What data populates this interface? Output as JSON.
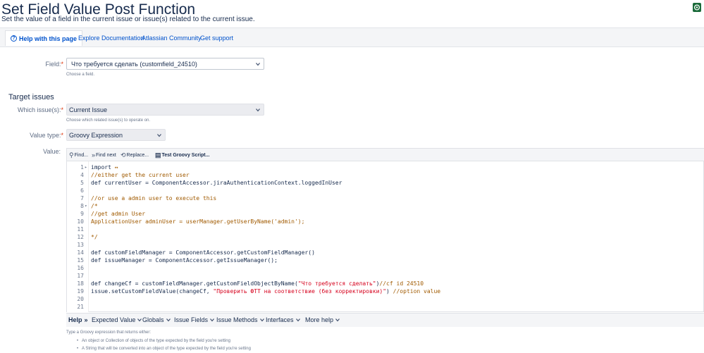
{
  "header": {
    "title": "Set Field Value Post Function",
    "subtitle": "Set the value of a field in the current issue or issue(s) related to the current issue."
  },
  "help_bar": {
    "active_tab": "Help with this page",
    "links": [
      "Explore Documentation",
      "Atlassian Community",
      "Get support"
    ]
  },
  "form": {
    "field": {
      "label": "Field:",
      "required_mark": "*",
      "value": "Что требуется сделать (customfield_24510)",
      "hint": "Choose a field."
    },
    "target_issues": {
      "title": "Target issues",
      "label": "Which issue(s):",
      "required_mark": "*",
      "value": "Current Issue",
      "hint": "Choose which related issue(s) to operate on."
    },
    "value_type": {
      "label": "Value type:",
      "required_mark": "*",
      "value": "Groovy Expression"
    },
    "value": {
      "label": "Value:"
    }
  },
  "editor": {
    "toolbar": {
      "find": "Find...",
      "find_next": "Find next",
      "replace": "Replace...",
      "test_script": "Test Groovy Script..."
    },
    "lines": [
      {
        "n": "1",
        "fold": "▸",
        "parts": [
          {
            "t": "import ",
            "c": "kw"
          },
          {
            "t": "↔",
            "c": "cm"
          }
        ]
      },
      {
        "n": "4",
        "fold": "",
        "parts": [
          {
            "t": "//either get the current user",
            "c": "cm"
          }
        ]
      },
      {
        "n": "5",
        "fold": "",
        "parts": [
          {
            "t": "def currentUser = ComponentAccessor.jiraAuthenticationContext.loggedInUser",
            "c": "kw"
          }
        ]
      },
      {
        "n": "6",
        "fold": "",
        "parts": []
      },
      {
        "n": "7",
        "fold": "",
        "parts": [
          {
            "t": "//or use a admin user to execute this",
            "c": "cm"
          }
        ]
      },
      {
        "n": "8",
        "fold": "▾",
        "parts": [
          {
            "t": "/*",
            "c": "cm"
          }
        ]
      },
      {
        "n": "9",
        "fold": "",
        "parts": [
          {
            "t": "//get admin User",
            "c": "cm"
          }
        ]
      },
      {
        "n": "10",
        "fold": "",
        "parts": [
          {
            "t": "ApplicationUser adminUser = userManager.getUserByName('admin');",
            "c": "cm"
          }
        ]
      },
      {
        "n": "11",
        "fold": "",
        "parts": []
      },
      {
        "n": "12",
        "fold": "",
        "parts": [
          {
            "t": "*/",
            "c": "cm"
          }
        ]
      },
      {
        "n": "13",
        "fold": "",
        "parts": []
      },
      {
        "n": "14",
        "fold": "",
        "parts": [
          {
            "t": "def customFieldManager = ComponentAccessor.getCustomFieldManager()",
            "c": "kw"
          }
        ]
      },
      {
        "n": "15",
        "fold": "",
        "parts": [
          {
            "t": "def issueManager = ComponentAccessor.getIssueManager();",
            "c": "kw"
          }
        ]
      },
      {
        "n": "16",
        "fold": "",
        "parts": []
      },
      {
        "n": "17",
        "fold": "",
        "parts": []
      },
      {
        "n": "18",
        "fold": "",
        "parts": [
          {
            "t": "def changeCf = customFieldManager.getCustomFieldObjectByName(",
            "c": "kw"
          },
          {
            "t": "\"Что требуется сделать\"",
            "c": "st"
          },
          {
            "t": ")",
            "c": "kw"
          },
          {
            "t": "//cf id 24510",
            "c": "cm"
          }
        ]
      },
      {
        "n": "19",
        "fold": "",
        "parts": [
          {
            "t": "issue.setCustomFieldValue(changeCf, ",
            "c": "kw"
          },
          {
            "t": "\"Проверить ФТТ на соответствие (без корректировки)\"",
            "c": "st"
          },
          {
            "t": ") ",
            "c": "kw"
          },
          {
            "t": "//option value",
            "c": "cm"
          }
        ]
      },
      {
        "n": "20",
        "fold": "",
        "parts": []
      },
      {
        "n": "21",
        "fold": "",
        "parts": []
      }
    ]
  },
  "help_menu": {
    "help_label": "Help",
    "items": [
      "Expected Value",
      "Globals",
      "Issue Fields",
      "Issue Methods",
      "Interfaces",
      "More help"
    ]
  },
  "description": {
    "intro": "Type a Groovy expression that returns either:",
    "bullets": [
      "An object or Collection of objects of the type expected by the field you're setting",
      "A String that will be converted into an object of the type expected by the field you're setting"
    ]
  }
}
